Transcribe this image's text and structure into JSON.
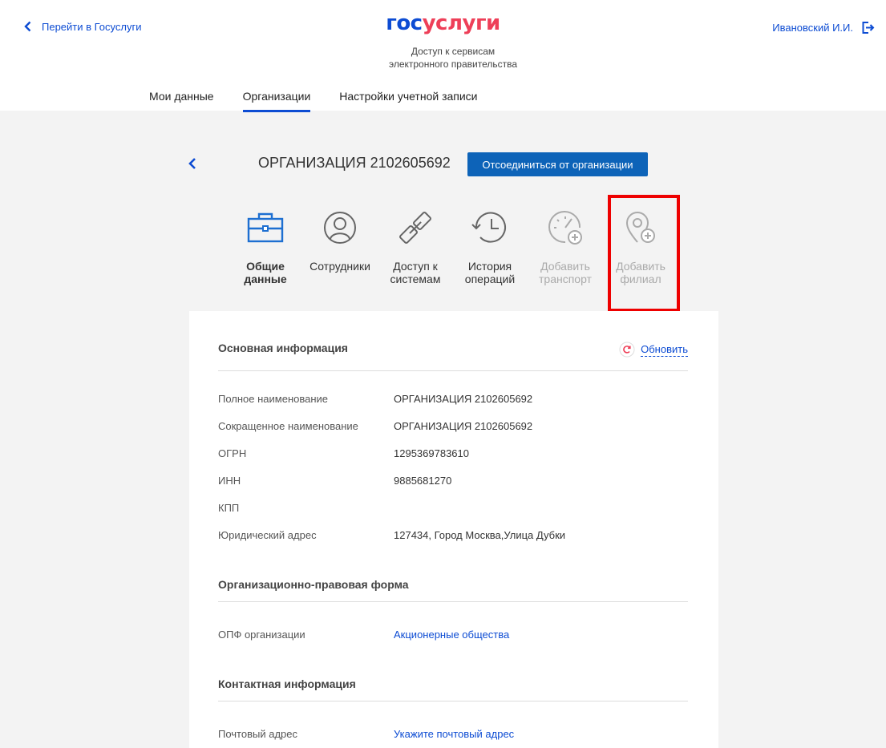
{
  "header": {
    "back_link": "Перейти в Госуслуги",
    "logo_part1": "гос",
    "logo_part2": "услуги",
    "tagline_line1": "Доступ к сервисам",
    "tagline_line2": "электронного правительства",
    "user_name": "Ивановский И.И."
  },
  "nav": {
    "tabs": [
      "Мои данные",
      "Организации",
      "Настройки учетной записи"
    ],
    "active": "Организации"
  },
  "org": {
    "title": "ОРГАНИЗАЦИЯ 2102605692",
    "disconnect_label": "Отсоединиться от организации"
  },
  "sections": [
    {
      "line1": "Общие",
      "line2": "данные",
      "icon": "briefcase-icon",
      "state": "active"
    },
    {
      "line1": "Сотрудники",
      "line2": "",
      "icon": "user-icon",
      "state": "normal"
    },
    {
      "line1": "Доступ к",
      "line2": "системам",
      "icon": "link-icon",
      "state": "normal"
    },
    {
      "line1": "История",
      "line2": "операций",
      "icon": "history-icon",
      "state": "normal"
    },
    {
      "line1": "Добавить",
      "line2": "транспорт",
      "icon": "speedometer-add-icon",
      "state": "disabled"
    },
    {
      "line1": "Добавить",
      "line2": "филиал",
      "icon": "location-add-icon",
      "state": "disabled"
    }
  ],
  "main_info": {
    "title": "Основная информация",
    "refresh_label": "Обновить",
    "rows": [
      {
        "label": "Полное наименование",
        "value": "ОРГАНИЗАЦИЯ 2102605692"
      },
      {
        "label": "Сокращенное наименование",
        "value": "ОРГАНИЗАЦИЯ 2102605692"
      },
      {
        "label": "ОГРН",
        "value": "1295369783610"
      },
      {
        "label": "ИНН",
        "value": "9885681270"
      },
      {
        "label": "КПП",
        "value": ""
      },
      {
        "label": "Юридический адрес",
        "value": "127434, Город Москва,Улица Дубки"
      }
    ]
  },
  "legal_form": {
    "title": "Организационно-правовая форма",
    "label": "ОПФ организации",
    "value": "Акционерные общества"
  },
  "contacts": {
    "title": "Контактная информация",
    "label": "Почтовый адрес",
    "value": "Укажите почтовый адрес"
  },
  "colors": {
    "accent": "#0d4cd3",
    "button": "#0d63b8",
    "brand_red": "#ee3f58",
    "highlight": "#ee0000"
  }
}
